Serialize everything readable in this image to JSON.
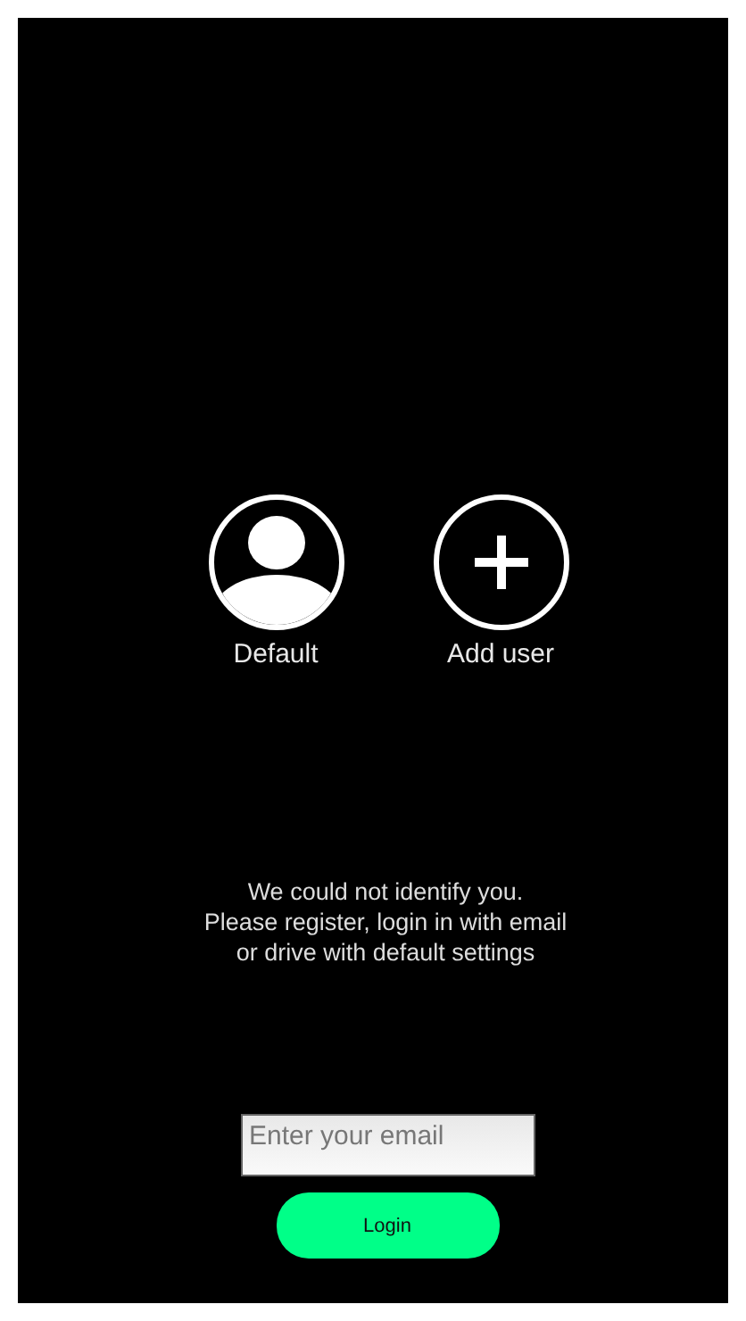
{
  "profiles": [
    {
      "kind": "default",
      "label": "Default"
    },
    {
      "kind": "add",
      "label": "Add user"
    }
  ],
  "message": "We could not identify you.\nPlease register, login in with email\nor drive with default settings",
  "email_field": {
    "placeholder": "Enter your email"
  },
  "login_button": {
    "label": "Login"
  }
}
